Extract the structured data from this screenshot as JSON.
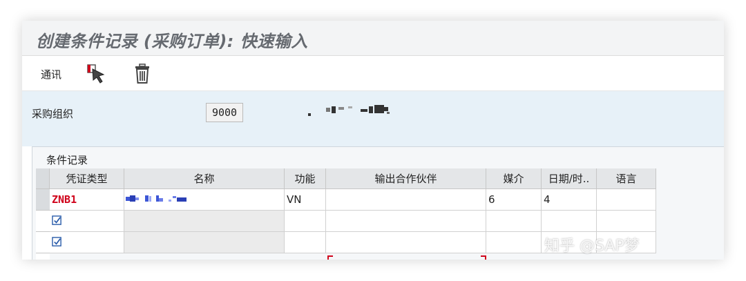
{
  "window": {
    "title": "创建条件记录 (采购订单): 快速输入"
  },
  "toolbar": {
    "comm_label": "通讯",
    "icons": [
      "select-cursor-icon",
      "trash-icon"
    ]
  },
  "header": {
    "purchasing_org_label": "采购组织",
    "purchasing_org_value": "9000"
  },
  "records": {
    "section_title": "条件记录",
    "columns": [
      "凭证类型",
      "名称",
      "功能",
      "输出合作伙伴",
      "媒介",
      "日期/时..",
      "语言"
    ],
    "rows": [
      {
        "doc_type": "ZNB1",
        "function": "VN",
        "partner": "",
        "medium": "6",
        "datetime": "4",
        "language": ""
      },
      {
        "doc_type": "",
        "function": "",
        "partner": "",
        "medium": "",
        "datetime": "",
        "language": ""
      },
      {
        "doc_type": "",
        "function": "",
        "partner": "",
        "medium": "",
        "datetime": "",
        "language": ""
      }
    ]
  },
  "watermark": {
    "text": "知乎 @SAP梦"
  },
  "colors": {
    "accent_red": "#d0021b",
    "header_bg": "#e7f1f8",
    "checkbox_blue": "#2a5caa"
  }
}
